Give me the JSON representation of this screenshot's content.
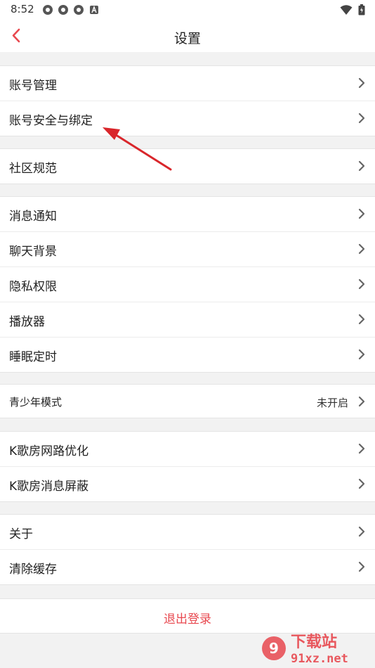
{
  "status": {
    "time": "8:52"
  },
  "header": {
    "title": "设置"
  },
  "groups": [
    {
      "items": [
        {
          "label": "账号管理"
        },
        {
          "label": "账号安全与绑定"
        }
      ]
    },
    {
      "items": [
        {
          "label": "社区规范"
        }
      ]
    },
    {
      "items": [
        {
          "label": "消息通知"
        },
        {
          "label": "聊天背景"
        },
        {
          "label": "隐私权限"
        },
        {
          "label": "播放器"
        },
        {
          "label": "睡眠定时"
        }
      ]
    },
    {
      "items": [
        {
          "label": "青少年模式",
          "value": "未开启"
        }
      ]
    },
    {
      "items": [
        {
          "label": "K歌房网路优化"
        },
        {
          "label": "K歌房消息屏蔽"
        }
      ]
    },
    {
      "items": [
        {
          "label": "关于"
        },
        {
          "label": "清除缓存"
        }
      ]
    }
  ],
  "logout": {
    "label": "退出登录"
  },
  "watermark": {
    "brand": "下载站",
    "site": "91xz.net"
  },
  "colors": {
    "accent": "#e8484f",
    "arrow": "#d9262b"
  }
}
